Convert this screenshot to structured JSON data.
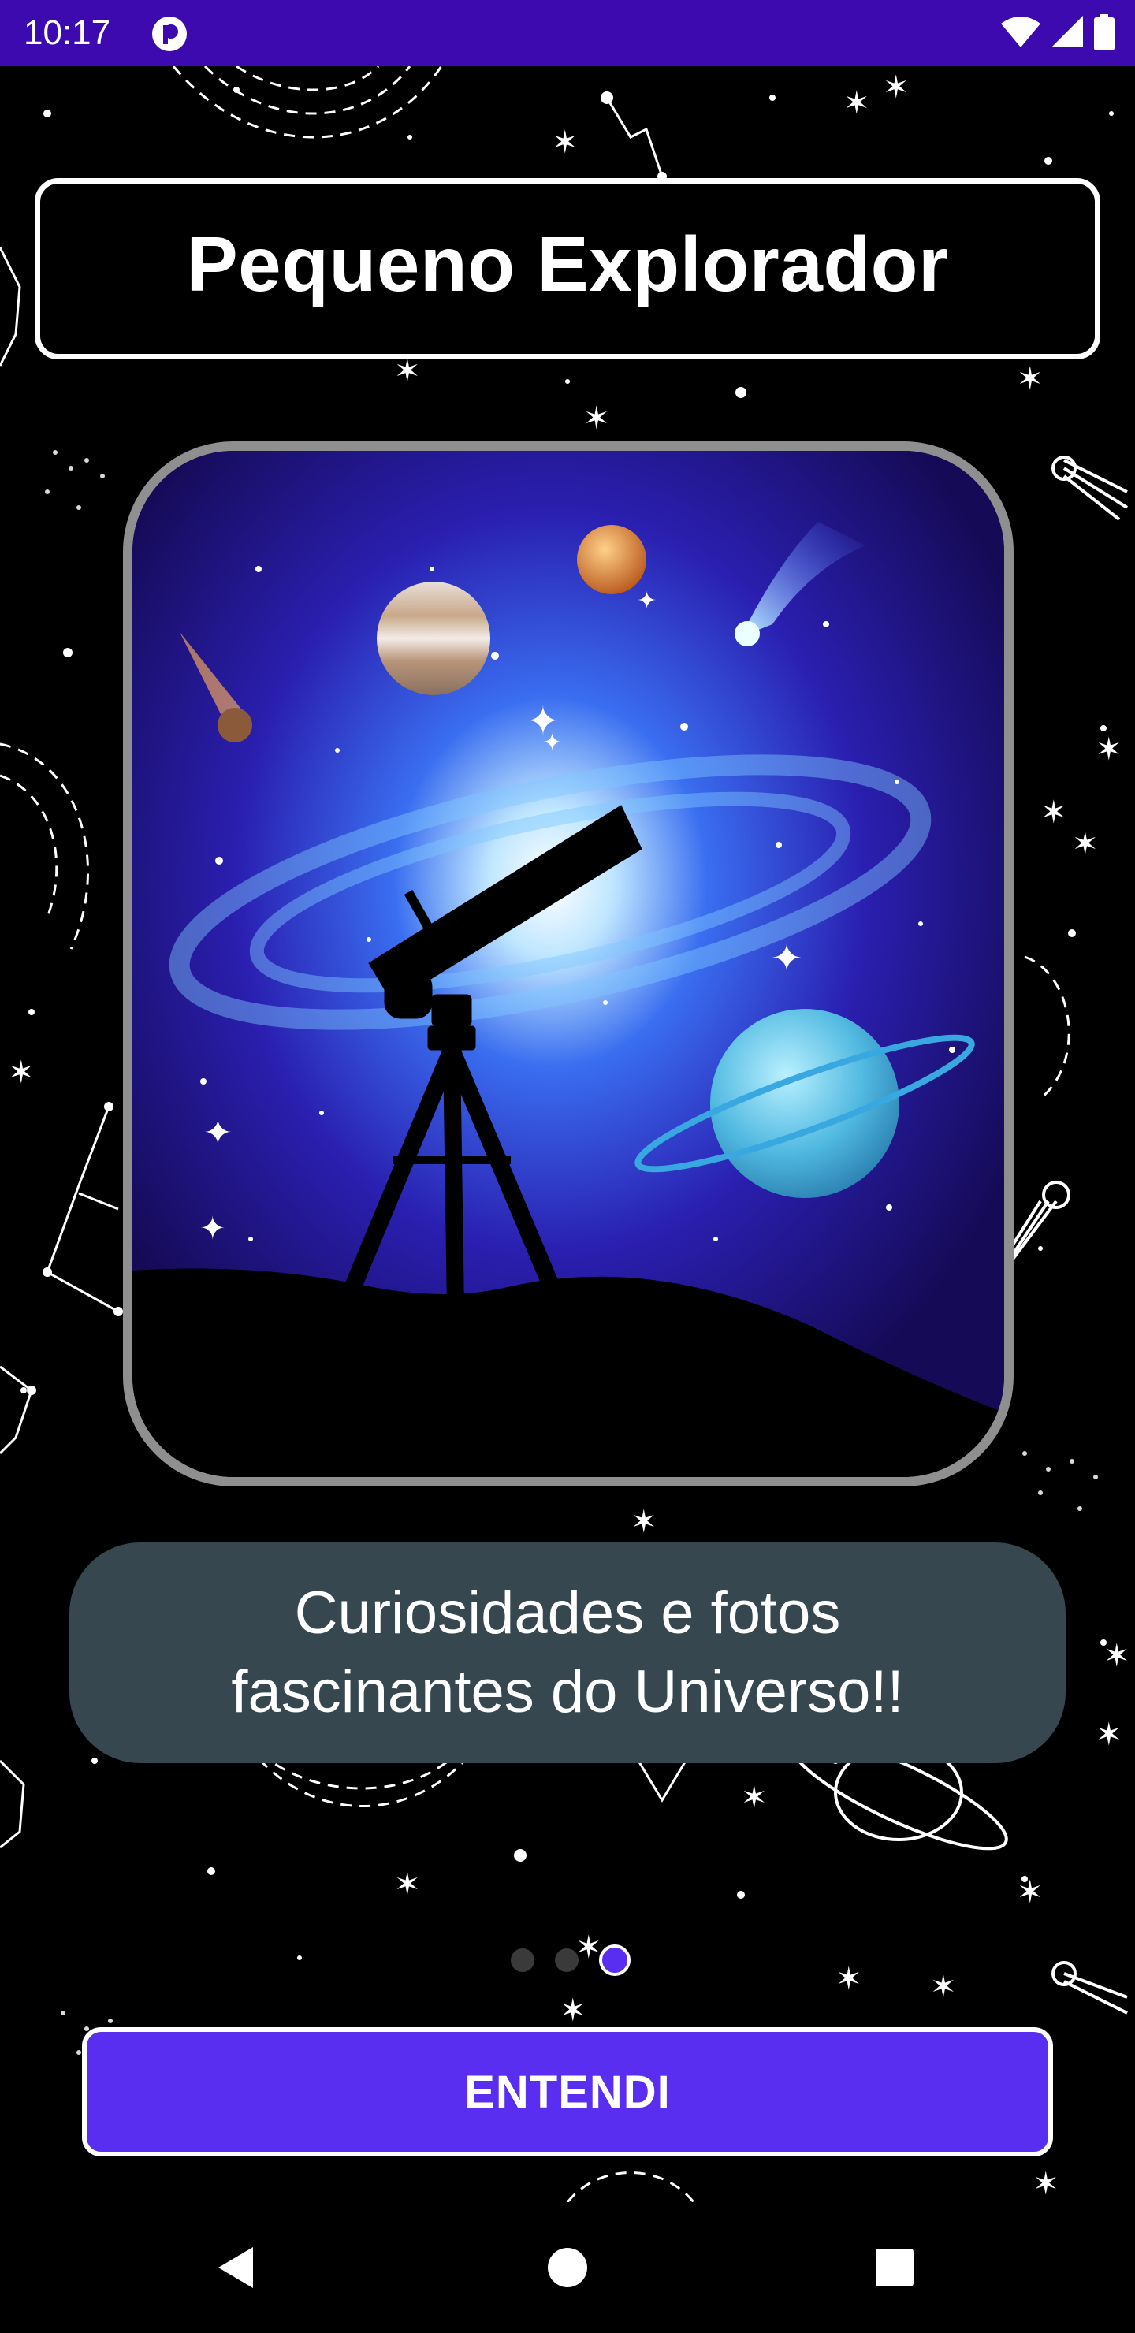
{
  "status_bar": {
    "time": "10:17",
    "app_icon": "p-logo-icon",
    "wifi_icon": "wifi-icon",
    "signal_icon": "cell-signal-icon",
    "battery_icon": "battery-icon",
    "background_color": "#3d0ab0"
  },
  "header": {
    "title": "Pequeno Explorador"
  },
  "illustration": {
    "subject": "telescope-galaxy-illustration"
  },
  "caption": {
    "text": "Curiosidades e fotos fascinantes do Universo!!"
  },
  "pager": {
    "total": 3,
    "current": 3
  },
  "actions": {
    "understood_label": "ENTENDI"
  },
  "navigation": {
    "back": "back-icon",
    "home": "home-icon",
    "recents": "recents-icon"
  },
  "colors": {
    "accent": "#5a2ef0",
    "caption_bg": "#37474f",
    "card_border": "#8f8f8f"
  }
}
